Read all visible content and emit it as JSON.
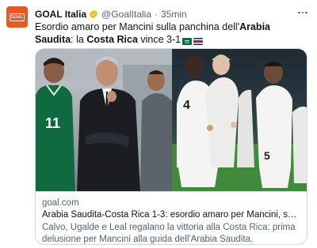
{
  "tweet": {
    "display_name": "GOAL Italia",
    "handle": "@GoalItalia",
    "separator": "·",
    "time": "35min",
    "text": {
      "part1": "Esordio amaro per Mancini sulla panchina dell'",
      "bold1": "Arabia Saudita",
      "part2": ": la ",
      "bold2": "Costa Rica",
      "part3": " vince 3-1"
    }
  },
  "card": {
    "domain": "goal.com",
    "title": "Arabia Saudita-Costa Rica 1-3: esordio amaro per Mancini, subito ko ...",
    "description": "Calvo, Ugalde e Leal regalano la vittoria alla Costa Rica: prima delusione per Mancini alla guida dell'Arabia Saudita."
  },
  "image_text": {
    "jersey_left": "11",
    "jersey_center": "4",
    "jersey_right": "5"
  },
  "colors": {
    "brand": "#e8562a",
    "verified": "#f4b400",
    "muted": "#536471",
    "border": "#cfd9de",
    "saudi_green": "#0f6b3f",
    "costa_rica_white": "#f4f4f2"
  },
  "icons": {
    "verified": "verified-badge-icon",
    "more": "more-options-icon",
    "flag_saudi": "saudi-arabia-flag-icon",
    "flag_costa_rica": "costa-rica-flag-icon"
  }
}
